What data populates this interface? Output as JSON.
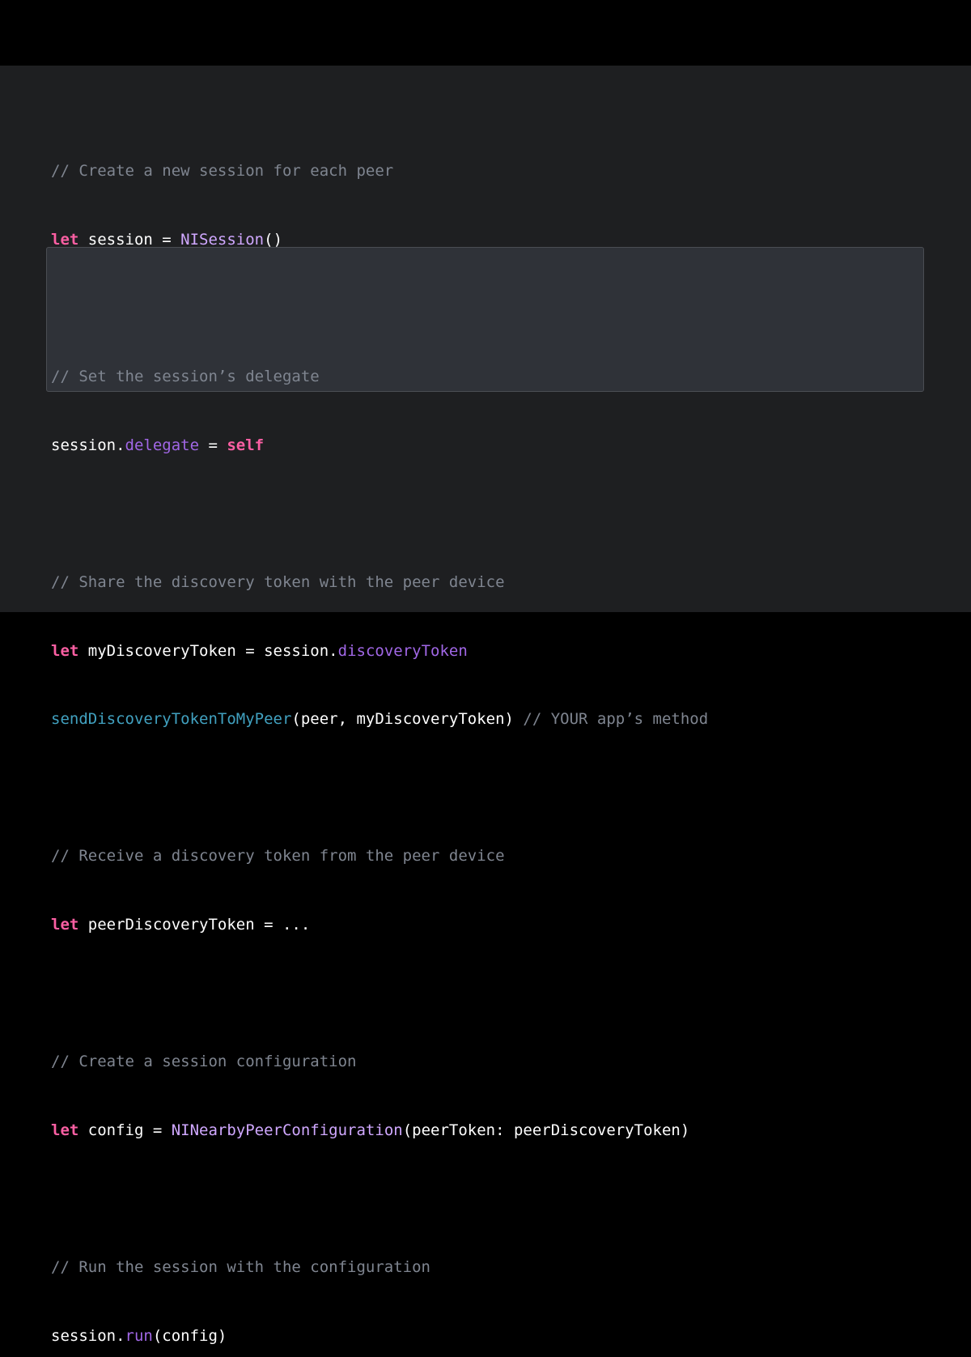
{
  "colors": {
    "background": "#1e1f21",
    "letterbox": "#000000",
    "highlight": "#2f3238",
    "comment": "#7f8590",
    "keyword": "#fc5fa3",
    "type": "#d0a8ff",
    "property": "#a167e6",
    "function": "#41a1c0",
    "plain": "#ffffff"
  },
  "code": {
    "c1": "// Create a new session for each peer",
    "l2_kw": "let",
    "l2_a": " session = ",
    "l2_type": "NISession",
    "l2_b": "()",
    "c4": "// Set the session’s delegate",
    "l5_a": "session.",
    "l5_prop": "delegate",
    "l5_b": " = ",
    "l5_kw": "self",
    "c7": "// Share the discovery token with the peer device",
    "l8_kw": "let",
    "l8_a": " myDiscoveryToken = session.",
    "l8_prop": "discoveryToken",
    "l9_func": "sendDiscoveryTokenToMyPeer",
    "l9_a": "(peer, myDiscoveryToken) ",
    "l9_comment": "// YOUR app’s method",
    "c11": "// Receive a discovery token from the peer device",
    "l12_kw": "let",
    "l12_a": " peerDiscoveryToken = ...",
    "c14": "// Create a session configuration",
    "l15_kw": "let",
    "l15_a": " config = ",
    "l15_type": "NINearbyPeerConfiguration",
    "l15_b": "(peerToken: peerDiscoveryToken)",
    "c17": "// Run the session with the configuration",
    "l18_a": "session.",
    "l18_prop": "run",
    "l18_b": "(config)"
  }
}
